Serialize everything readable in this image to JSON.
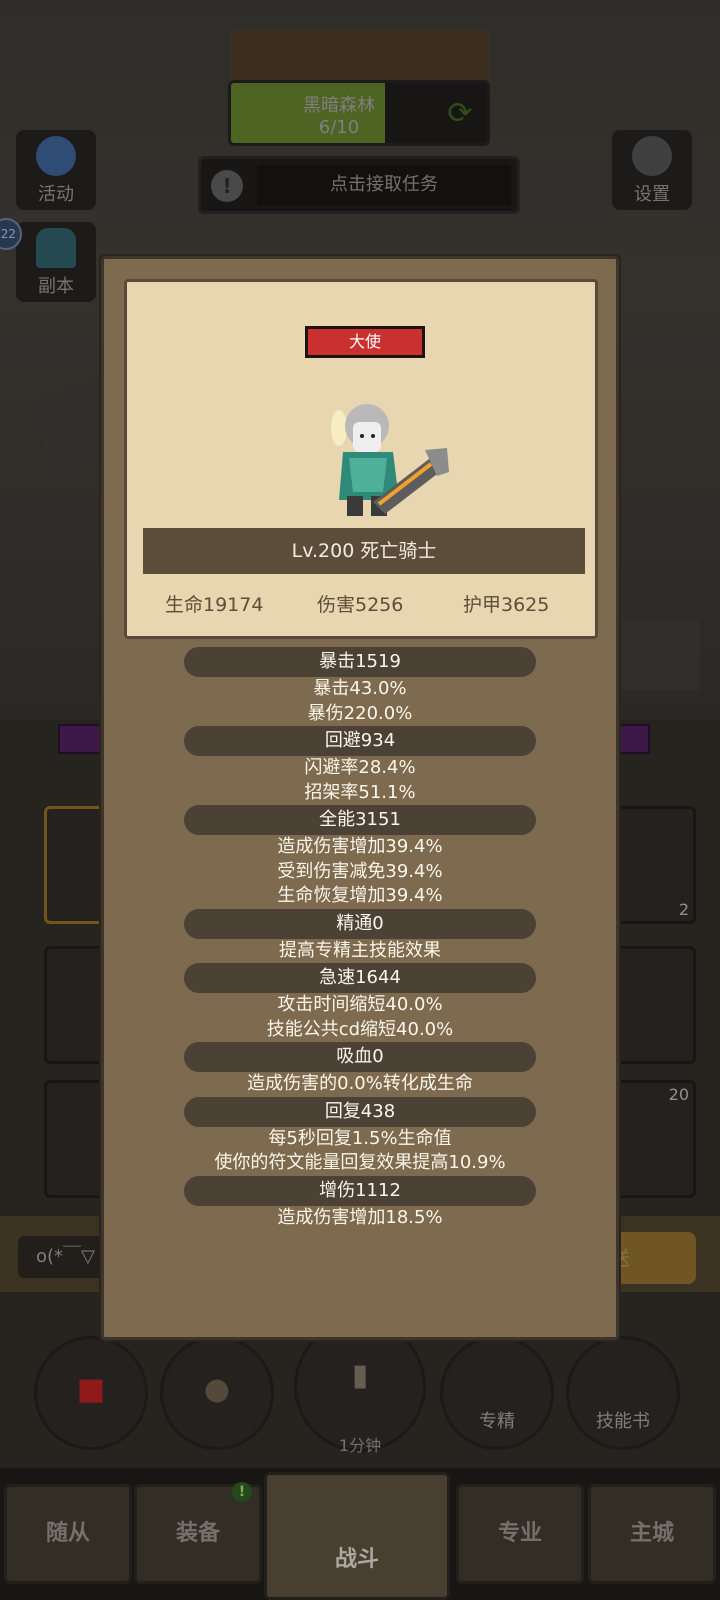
{
  "background": {
    "stage": {
      "name": "黑暗森林",
      "progress": "6/10",
      "progress_fraction": 0.6
    },
    "quest": {
      "label": "点击接取任务"
    },
    "side_left": [
      {
        "label": "活动",
        "icon": "star-icon"
      },
      {
        "label": "副本",
        "icon": "dungeon-gate-icon"
      }
    ],
    "side_right": [
      {
        "label": "设置",
        "icon": "gear-icon"
      }
    ],
    "level_badge": "22",
    "slot_counts": [
      "2",
      "20"
    ],
    "chat": {
      "input": "o(*￣▽",
      "send": "送"
    },
    "circle_buttons": [
      {
        "label": "",
        "icon": "potion-icon"
      },
      {
        "label": "",
        "icon": "bread-icon"
      },
      {
        "label": "",
        "icon": "hourglass-icon"
      },
      {
        "label": "专精",
        "icon": "target-icon"
      },
      {
        "label": "技能书",
        "icon": "book-icon"
      }
    ],
    "timer": "1分钟",
    "nav": [
      {
        "label": "随从"
      },
      {
        "label": "装备",
        "badge": "!"
      },
      {
        "label": "战斗",
        "active": true
      },
      {
        "label": "专业"
      },
      {
        "label": "主城"
      }
    ]
  },
  "hero": {
    "title_badge": "大使",
    "name": "Lv.200 死亡骑士",
    "hp": "生命19174",
    "damage": "伤害5256",
    "armor": "护甲3625"
  },
  "stats": [
    {
      "header": "暴击1519",
      "lines": [
        "暴击43.0%",
        "暴伤220.0%"
      ]
    },
    {
      "header": "回避934",
      "lines": [
        "闪避率28.4%",
        "招架率51.1%"
      ]
    },
    {
      "header": "全能3151",
      "lines": [
        "造成伤害增加39.4%",
        "受到伤害减免39.4%",
        "生命恢复增加39.4%"
      ]
    },
    {
      "header": "精通0",
      "lines": [
        "提高专精主技能效果"
      ]
    },
    {
      "header": "急速1644",
      "lines": [
        "攻击时间缩短40.0%",
        "技能公共cd缩短40.0%"
      ]
    },
    {
      "header": "吸血0",
      "lines": [
        "造成伤害的0.0%转化成生命"
      ]
    },
    {
      "header": "回复438",
      "lines": [
        "每5秒回复1.5%生命值",
        "使你的符文能量回复效果提高10.9%"
      ]
    },
    {
      "header": "增伤1112",
      "lines": [
        "造成伤害增加18.5%"
      ]
    }
  ]
}
